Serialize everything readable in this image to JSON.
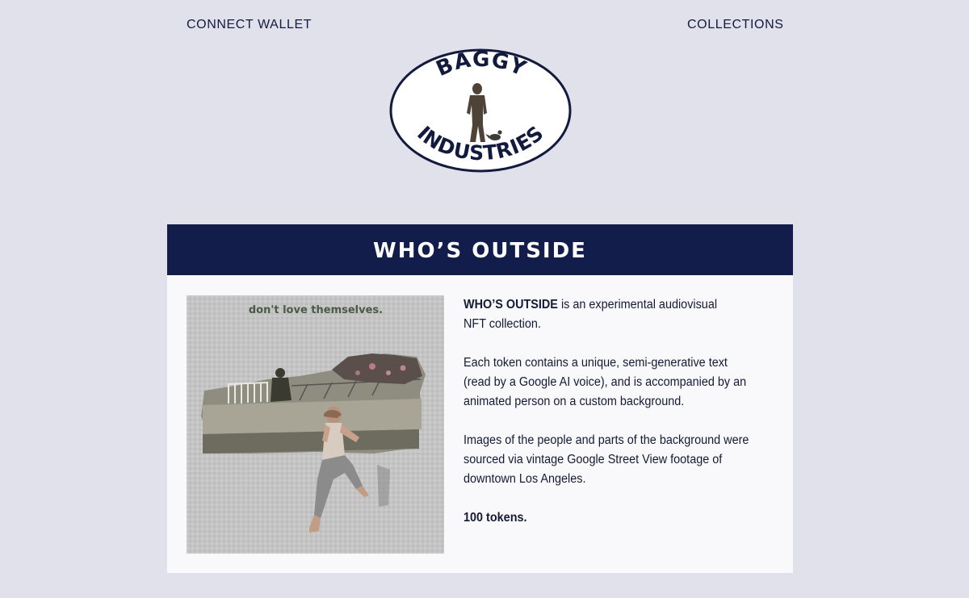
{
  "nav": {
    "connect_wallet": "CONNECT WALLET",
    "collections": "COLLECTIONS"
  },
  "logo": {
    "top_text": "BAGGY",
    "bottom_text": "INDUSTRIES",
    "icon": "person-and-pigeon-logo"
  },
  "collection": {
    "title": "WHO’S OUTSIDE",
    "artwork_caption": "don't love themselves.",
    "paragraph1_lead": "WHO’S OUTSIDE",
    "paragraph1_rest_a": " is an experimental audiovisual",
    "paragraph1_rest_b": "NFT collection.",
    "paragraph2": "Each token contains a unique, semi-generative text (read by a Google AI voice), and is accompanied by an animated person on a custom background.",
    "paragraph3": "Images of the people and parts of the background were sourced via vintage Google Street View footage of downtown Los Angeles.",
    "token_count": "100 tokens."
  },
  "colors": {
    "page_background": "#e0e1ea",
    "header_navy": "#121d4c",
    "text_navy": "#121a3e",
    "card_background": "#f9f9fb"
  }
}
